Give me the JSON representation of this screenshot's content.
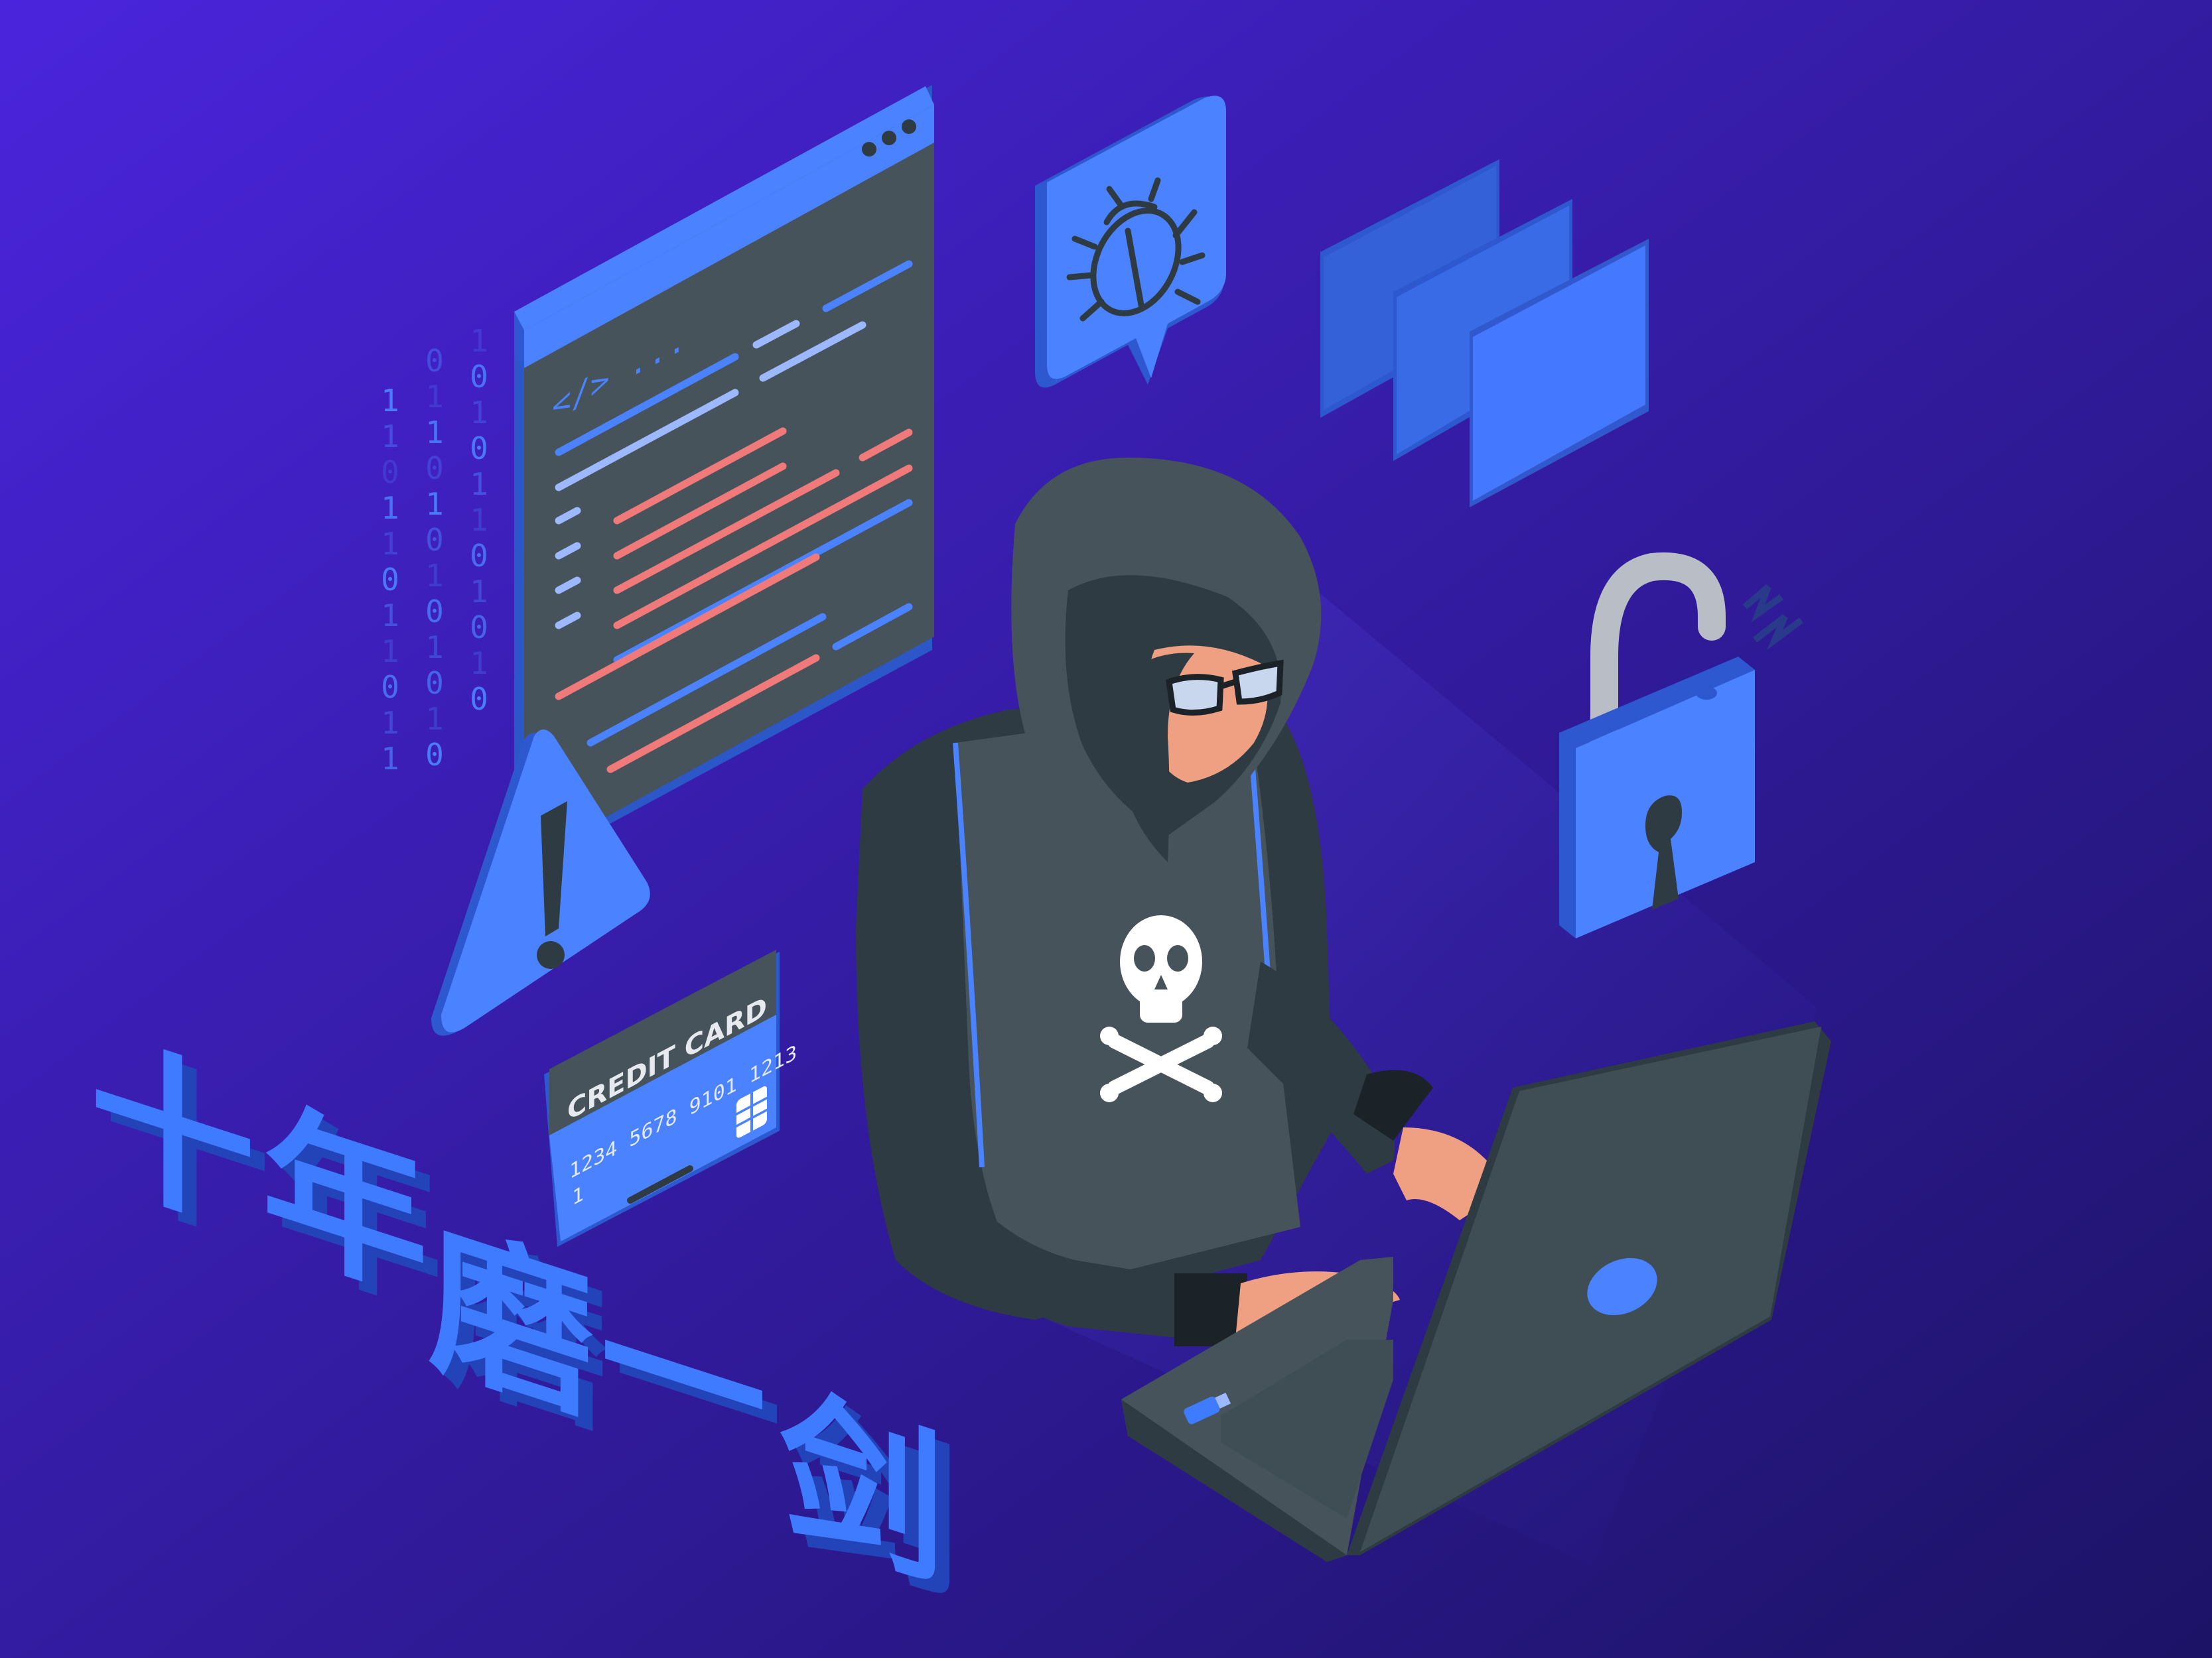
{
  "colors": {
    "bg_top": "#4624d8",
    "bg_bottom": "#1e1470",
    "accent_blue": "#3f7bff",
    "accent_blue_dark": "#2e58d0",
    "slate": "#3f4d55",
    "slate_dark": "#2f3b42",
    "skin": "#f0a082",
    "code_red": "#f07a7a",
    "code_light": "#9cb8ff"
  },
  "code_window": {
    "tag_text": "</> ..."
  },
  "binary_columns": [
    [
      "1",
      "1",
      "0",
      "1",
      "1",
      "0",
      "1",
      "1",
      "0",
      "1",
      "1"
    ],
    [
      "0",
      "1",
      "1",
      "0",
      "1",
      "0",
      "1",
      "0",
      "1",
      "0",
      "1",
      "0"
    ],
    [
      "1",
      "0",
      "1",
      "0",
      "1",
      "1",
      "0",
      "1",
      "0",
      "1",
      "0"
    ]
  ],
  "credit_card": {
    "title": "CREDIT CARD",
    "number": "1234 5678 9101 1213",
    "extra_line": "1"
  },
  "banner": {
    "characters": [
      "十",
      "年",
      "磨",
      "一",
      "剑"
    ]
  },
  "icons": {
    "bug": "bug-icon",
    "warning": "warning-icon",
    "lock": "unlocked-padlock-icon",
    "folders": "folder-icon",
    "skull": "skull-crossbones-icon",
    "usb": "usb-drive-icon"
  }
}
